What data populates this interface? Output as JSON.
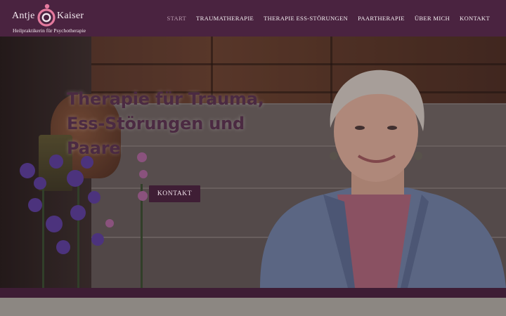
{
  "brand": {
    "first_name": "Antje",
    "last_name": "Kaiser",
    "tagline": "Heilpraktikerin für Psychotherapie"
  },
  "nav": {
    "items": [
      {
        "label": "Start",
        "active": true
      },
      {
        "label": "Traumatherapie",
        "active": false
      },
      {
        "label": "Therapie Ess-Störungen",
        "active": false
      },
      {
        "label": "Paartherapie",
        "active": false
      },
      {
        "label": "Über mich",
        "active": false
      },
      {
        "label": "Kontakt",
        "active": false
      }
    ]
  },
  "hero": {
    "title": "Therapie für Trauma, Ess-Störungen und Paare",
    "button_label": "KONTAKT"
  },
  "colors": {
    "header_bg": "#4a2340",
    "accent": "#3f1e35",
    "nav_active": "#b99aae",
    "logo_circle": "#e47a9e"
  },
  "icons": [
    "logo-mark-icon"
  ]
}
